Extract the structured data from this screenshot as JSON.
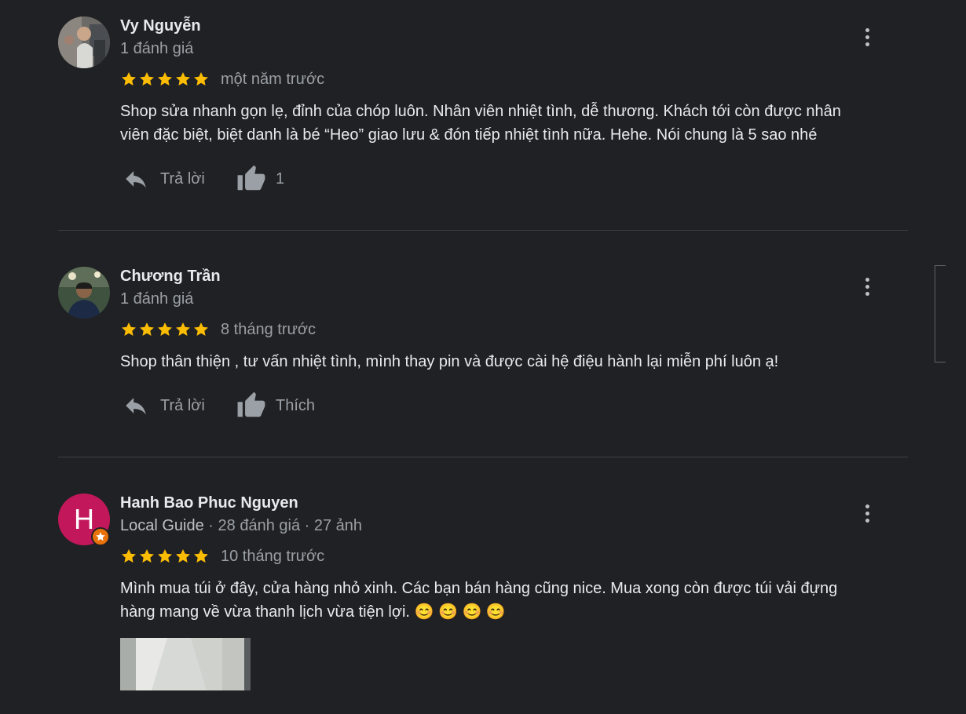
{
  "reviews": [
    {
      "author": "Vy Nguyễn",
      "meta": "1 đánh giá",
      "rating": 5,
      "date": "một năm trước",
      "text_lines": [
        "Shop sửa nhanh gọn lẹ, đỉnh của chóp luôn. Nhân viên nhiệt tình, dễ thương. Khách tới còn được nhân",
        "viên đặc biệt, biệt danh là bé “Heo” giao lưu & đón tiếp nhiệt tình nữa. Hehe. Nói chung là 5 sao nhé"
      ],
      "reply_label": "Trả lời",
      "like_label": "1"
    },
    {
      "author": "Chương Trần",
      "meta": "1 đánh giá",
      "rating": 5,
      "date": "8 tháng trước",
      "text_lines": [
        "Shop thân thiện , tư vấn nhiệt tình, mình thay pin và được cài hệ điệu hành lại miễn phí luôn ạ!"
      ],
      "reply_label": "Trả lời",
      "like_label": "Thích"
    },
    {
      "author": "Hanh Bao Phuc Nguyen",
      "avatar_letter": "H",
      "meta_guide": "Local Guide",
      "meta_rest": " · 28 đánh giá · 27 ảnh",
      "rating": 5,
      "date": "10 tháng trước",
      "text_lines": [
        "Mình mua túi ở đây, cửa hàng nhỏ xinh. Các bạn bán hàng cũng nice. Mua xong còn được túi vải đựng",
        "hàng mang về vừa thanh lịch vừa tiện lợi."
      ],
      "emojis": "😊 😊 😊 😊"
    }
  ],
  "colors": {
    "background": "#202124",
    "star": "#fbbc04",
    "text_primary": "#e8eaed",
    "text_secondary": "#9aa0a6",
    "divider": "#3c4043",
    "local_guide_badge": "#e8710a",
    "letter_avatar": "#c2185b"
  },
  "icons": [
    "more-vert-icon",
    "reply-icon",
    "thumb-up-icon",
    "star-icon",
    "local-guide-badge-icon"
  ]
}
